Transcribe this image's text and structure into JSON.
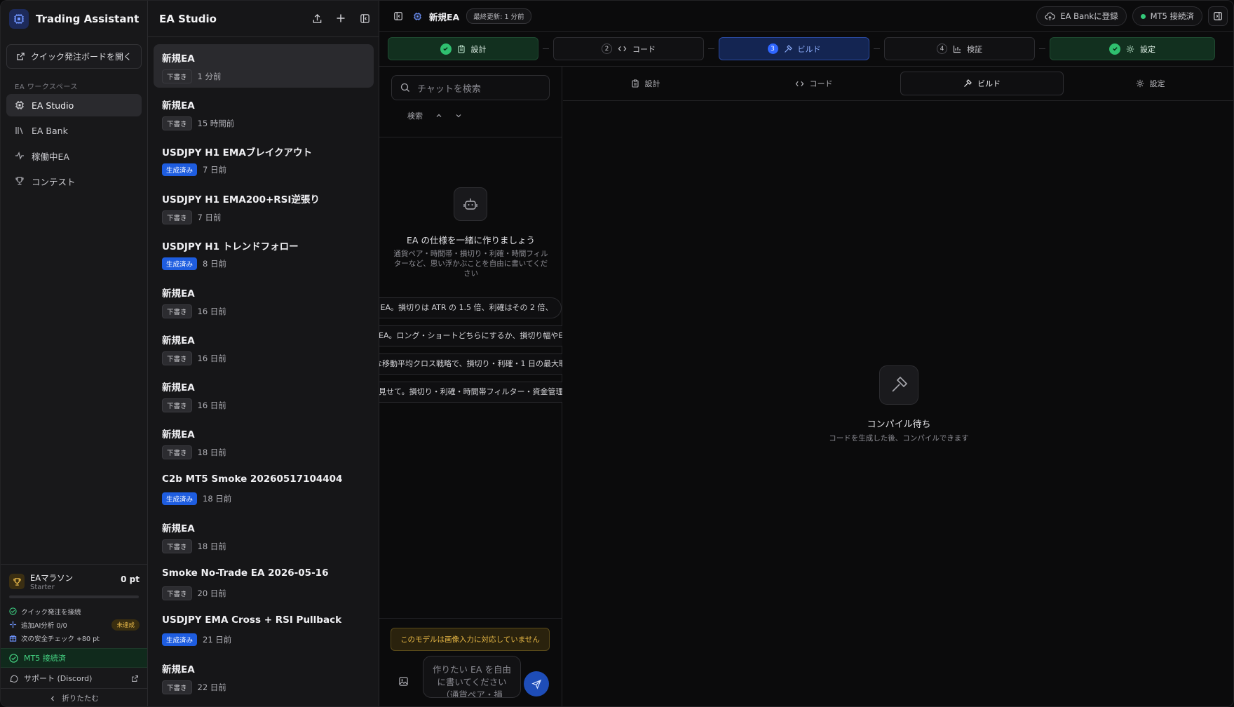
{
  "sidebar": {
    "app_title": "Trading Assistant",
    "quick_board_label": "クイック発注ボードを開く",
    "workspace_label": "EA ワークスペース",
    "nav": [
      {
        "label": "EA Studio",
        "icon": "cpu-icon",
        "active": true
      },
      {
        "label": "EA Bank",
        "icon": "library-icon"
      },
      {
        "label": "稼働中EA",
        "icon": "activity-icon"
      },
      {
        "label": "コンテスト",
        "icon": "trophy-icon"
      }
    ],
    "marathon": {
      "name": "EAマラソン",
      "plan": "Starter",
      "points": "0 pt",
      "progress": 0
    },
    "checks": [
      {
        "label": "クイック発注を接続",
        "icon": "shield-check-icon"
      },
      {
        "label": "追加AI分析 0/0",
        "icon": "sparkle-icon",
        "badge": "未達成"
      },
      {
        "label": "次の安全チェック +80 pt",
        "icon": "gift-icon"
      }
    ],
    "mt5_status": "MT5 接続済",
    "support_label": "サポート (Discord)",
    "collapse_label": "折りたたむ"
  },
  "list": {
    "title": "EA Studio",
    "items": [
      {
        "name": "新規EA",
        "status": "下書き",
        "status_type": "draft",
        "time": "1 分前",
        "active": true
      },
      {
        "name": "新規EA",
        "status": "下書き",
        "status_type": "draft",
        "time": "15 時間前"
      },
      {
        "name": "USDJPY H1 EMAブレイクアウト",
        "status": "生成済み",
        "status_type": "done",
        "time": "7 日前"
      },
      {
        "name": "USDJPY H1 EMA200+RSI逆張り",
        "status": "下書き",
        "status_type": "draft",
        "time": "7 日前"
      },
      {
        "name": "USDJPY H1 トレンドフォロー",
        "status": "生成済み",
        "status_type": "done",
        "time": "8 日前"
      },
      {
        "name": "新規EA",
        "status": "下書き",
        "status_type": "draft",
        "time": "16 日前"
      },
      {
        "name": "新規EA",
        "status": "下書き",
        "status_type": "draft",
        "time": "16 日前"
      },
      {
        "name": "新規EA",
        "status": "下書き",
        "status_type": "draft",
        "time": "16 日前"
      },
      {
        "name": "新規EA",
        "status": "下書き",
        "status_type": "draft",
        "time": "18 日前"
      },
      {
        "name": "C2b MT5 Smoke 20260517104404",
        "status": "生成済み",
        "status_type": "done",
        "time": "18 日前"
      },
      {
        "name": "新規EA",
        "status": "下書き",
        "status_type": "draft",
        "time": "18 日前"
      },
      {
        "name": "Smoke No-Trade EA 2026-05-16",
        "status": "下書き",
        "status_type": "draft",
        "time": "20 日前"
      },
      {
        "name": "USDJPY EMA Cross + RSI Pullback",
        "status": "生成済み",
        "status_type": "done",
        "time": "21 日前"
      },
      {
        "name": "新規EA",
        "status": "下書き",
        "status_type": "draft",
        "time": "22 日前"
      }
    ]
  },
  "topbar": {
    "title": "新規EA",
    "updated": "最終更新: 1 分前",
    "register_label": "EA Bankに登録",
    "mt5_label": "MT5 接続済"
  },
  "steps": [
    {
      "label": "設計",
      "state": "done",
      "icon": "clipboard-icon"
    },
    {
      "num": "2",
      "label": "コード",
      "state": "todo",
      "icon": "code-icon"
    },
    {
      "num": "3",
      "label": "ビルド",
      "state": "current",
      "icon": "hammer-icon"
    },
    {
      "num": "4",
      "label": "検証",
      "state": "todo",
      "icon": "bar-chart-icon"
    },
    {
      "label": "設定",
      "state": "done",
      "icon": "gear-icon"
    }
  ],
  "chat": {
    "search_placeholder": "チャットを検索",
    "search_label": "検索",
    "intro_title": "EA の仕様を一緒に作りましょう",
    "intro_desc": "通貨ペア・時間帯・損切り・利確・時間フィルターなど、思い浮かぶことを自由に書いてください",
    "suggestions": [
      "ー EA。損切りは ATR の 1.5 倍、利確はその 2 倍、",
      "EA。ロング・ショートどちらにするか、損切り幅やE",
      "な移動平均クロス戦略で、損切り・利確・1 日の最大取",
      "見せて。損切り・利確・時間帯フィルター・資金管理"
    ],
    "warning": "このモデルは画像入力に対応していません",
    "composer_placeholder": "作りたい EA を自由に書いてください（通貨ペア・損"
  },
  "work": {
    "tabs": [
      {
        "label": "設計",
        "icon": "clipboard-icon"
      },
      {
        "label": "コード",
        "icon": "code-icon"
      },
      {
        "label": "ビルド",
        "icon": "hammer-icon",
        "active": true
      },
      {
        "label": "設定",
        "icon": "gear-icon"
      }
    ],
    "empty_title": "コンパイル待ち",
    "empty_desc": "コードを生成した後、コンパイルできます"
  }
}
